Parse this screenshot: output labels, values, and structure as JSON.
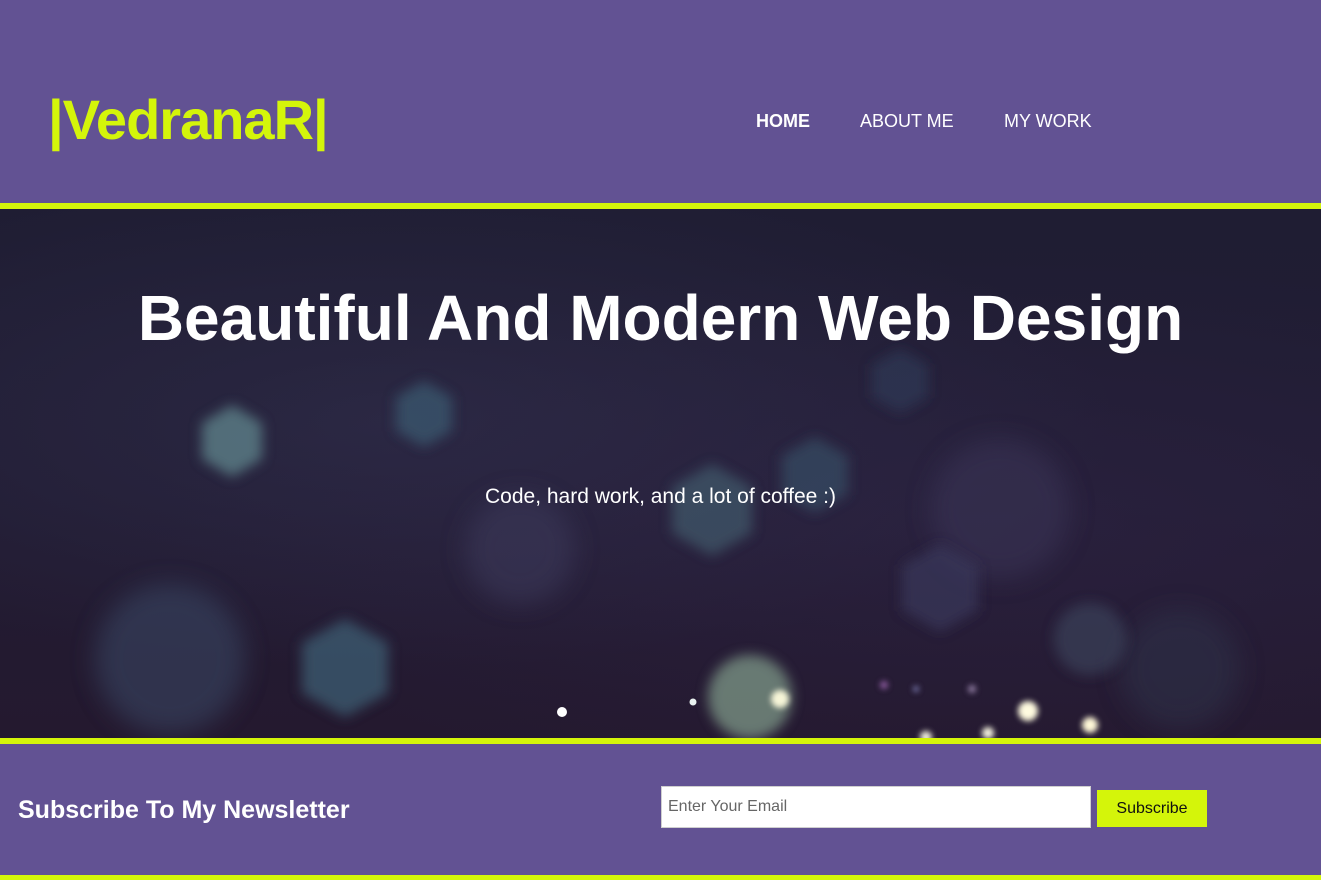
{
  "header": {
    "logo": "|VedranaR|",
    "nav": [
      {
        "label": "HOME",
        "active": true
      },
      {
        "label": "ABOUT ME",
        "active": false
      },
      {
        "label": "MY WORK",
        "active": false
      }
    ]
  },
  "hero": {
    "title": "Beautiful And Modern Web Design",
    "subtitle": "Code, hard work, and a lot of coffee :)"
  },
  "newsletter": {
    "title": "Subscribe To My Newsletter",
    "email_placeholder": "Enter Your Email",
    "email_value": "",
    "subscribe_label": "Subscribe"
  },
  "colors": {
    "brand_purple": "#625293",
    "accent_lime": "#d4f50a",
    "hero_dark": "#211c33",
    "text_white": "#ffffff"
  }
}
